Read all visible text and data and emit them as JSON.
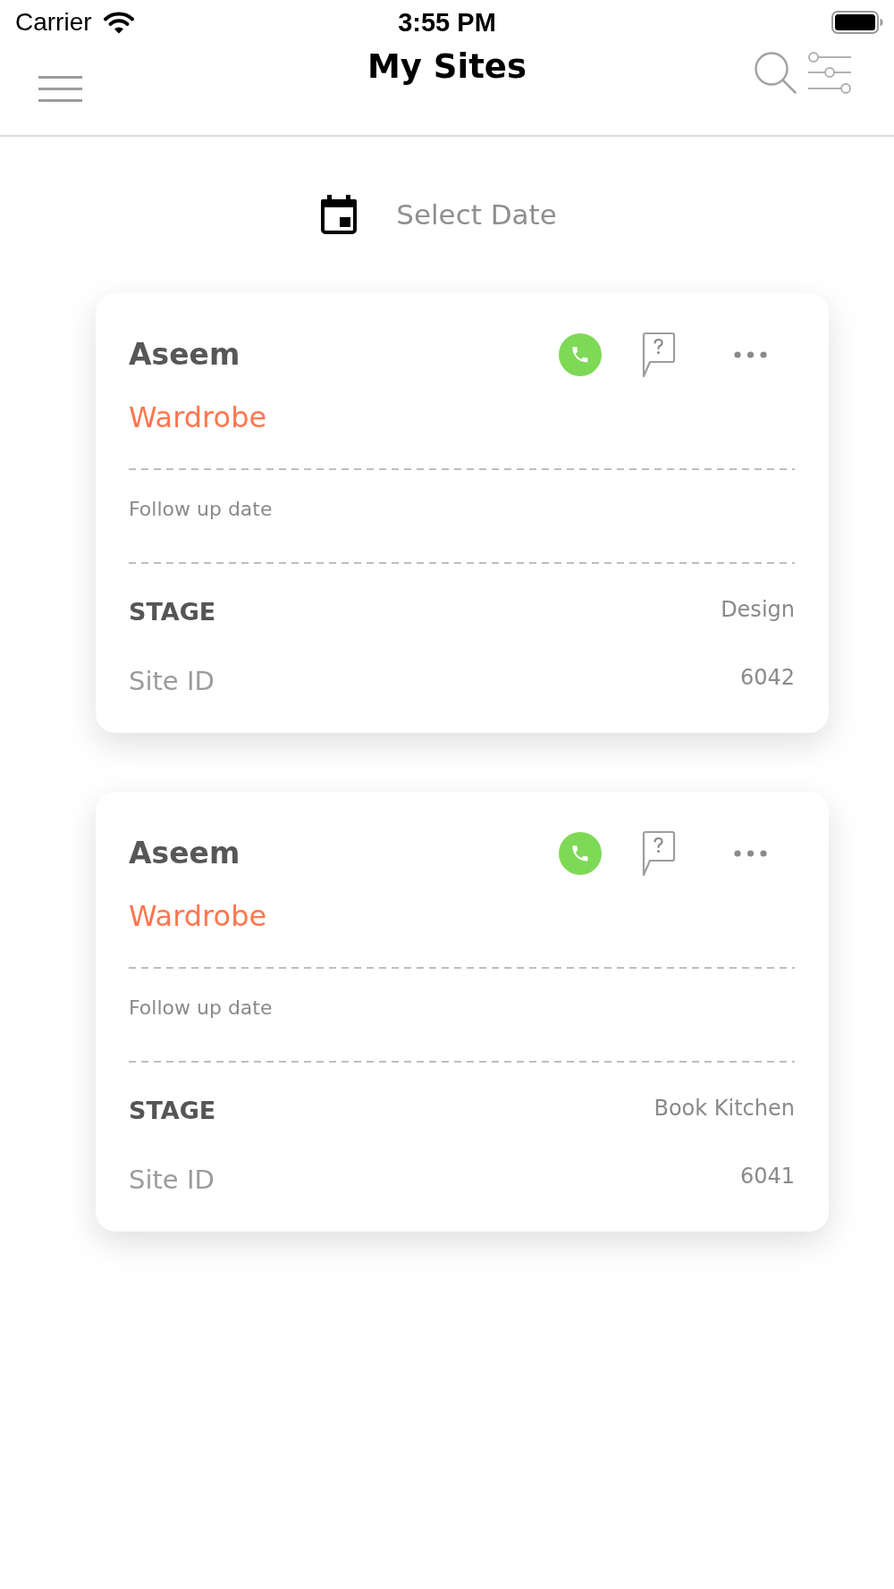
{
  "status_bar": {
    "carrier": "Carrier",
    "time": "3:55 PM"
  },
  "nav_bar": {
    "title": "My Sites"
  },
  "date_filter": {
    "label": "Select Date"
  },
  "sites": [
    {
      "name": "Aseem",
      "category": "Wardrobe",
      "follow_up_label": "Follow up date",
      "stage_label": "STAGE",
      "stage": "Design",
      "site_id_label": "Site ID",
      "site_id": "6042"
    },
    {
      "name": "Aseem",
      "category": "Wardrobe",
      "follow_up_label": "Follow up date",
      "stage_label": "STAGE",
      "stage": "Book Kitchen",
      "site_id_label": "Site ID",
      "site_id": "6041"
    }
  ]
}
